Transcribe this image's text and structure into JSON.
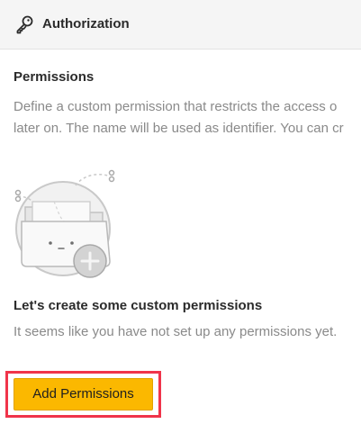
{
  "header": {
    "title": "Authorization",
    "icon": "key-icon"
  },
  "permissions": {
    "title": "Permissions",
    "description_lines": [
      "Define a custom permission that restricts the access o",
      "later on. The name will be used as identifier. You can cr"
    ]
  },
  "empty_state": {
    "illustration": "folder-add-illustration",
    "title": "Let's create some custom permissions",
    "text": "It seems like you have not set up any permissions yet."
  },
  "actions": {
    "add_label": "Add Permissions"
  },
  "colors": {
    "accent": "#fbb800",
    "highlight": "#f0344a",
    "header_bg": "#f5f5f5",
    "muted_text": "#8a8a8a"
  }
}
